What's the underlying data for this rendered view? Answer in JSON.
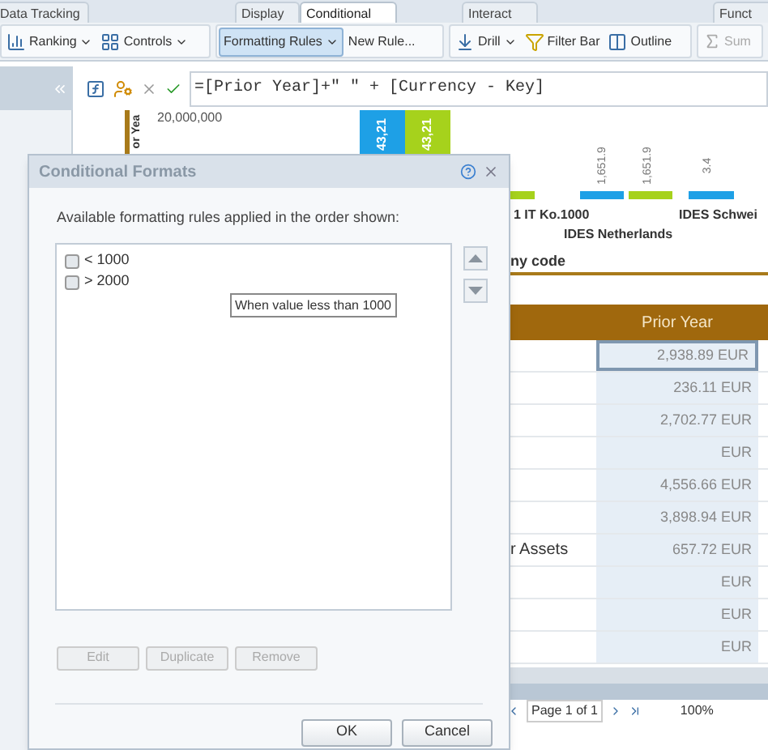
{
  "ribbon_tabs": [
    {
      "label": "Data Tracking",
      "selected": false
    },
    {
      "label": "Display",
      "selected": false
    },
    {
      "label": "Conditional",
      "selected": true
    },
    {
      "label": "Interact",
      "selected": false
    },
    {
      "label": "Funct",
      "selected": false
    }
  ],
  "toolbar_groups": [
    {
      "items": [
        {
          "kind": "ranking",
          "label": "Ranking",
          "dropdown": true,
          "pressed": false,
          "disabled": false
        },
        {
          "kind": "controls",
          "label": "Controls",
          "dropdown": true,
          "pressed": false,
          "disabled": false
        }
      ]
    },
    {
      "items": [
        {
          "kind": "plain",
          "label": "Formatting Rules",
          "dropdown": true,
          "pressed": true,
          "disabled": false
        },
        {
          "kind": "plain",
          "label": "New Rule...",
          "dropdown": false,
          "pressed": false,
          "disabled": false
        }
      ]
    },
    {
      "items": [
        {
          "kind": "drill",
          "label": "Drill",
          "dropdown": true,
          "pressed": false,
          "disabled": false
        },
        {
          "kind": "filter",
          "label": "Filter Bar",
          "dropdown": false,
          "pressed": false,
          "disabled": false
        },
        {
          "kind": "outline",
          "label": "Outline",
          "dropdown": false,
          "pressed": false,
          "disabled": false
        }
      ]
    },
    {
      "items": [
        {
          "kind": "sum",
          "label": "Sum",
          "dropdown": false,
          "pressed": false,
          "disabled": true
        }
      ]
    }
  ],
  "formula_bar": {
    "value": "=[Prior Year]+\" \" + [Currency - Key]"
  },
  "chart": {
    "axis_title": "or Yea",
    "y_tick": "20,000,000",
    "top_bar_labels": [
      "43,21",
      "43,21"
    ],
    "right_bar_labels": [
      "1,651.9",
      "1,651.9",
      "3.4"
    ],
    "categories": [
      "1 IT Ko.1000",
      "IDES Schwei",
      "IDES Netherlands"
    ]
  },
  "section_label": "ny code",
  "table": {
    "header": "Prior Year",
    "rows": [
      {
        "value": "2,938.89 EUR",
        "selected": true
      },
      {
        "value": "236.11 EUR",
        "selected": false
      },
      {
        "value": "2,702.77 EUR",
        "selected": false
      },
      {
        "value": "EUR",
        "selected": false
      },
      {
        "value": "4,556.66 EUR",
        "selected": false
      },
      {
        "value": "3,898.94 EUR",
        "selected": false
      },
      {
        "label": "r Assets",
        "value": "657.72 EUR",
        "selected": false
      },
      {
        "value": "EUR",
        "selected": false
      },
      {
        "value": "EUR",
        "selected": false
      },
      {
        "value": "EUR",
        "selected": false
      }
    ]
  },
  "pager": {
    "page": "Page 1 of 1",
    "zoom": "100%"
  },
  "dialog": {
    "title": "Conditional Formats",
    "instruction": "Available formatting rules applied in the order shown:",
    "rules": [
      {
        "label": "< 1000",
        "checked": false
      },
      {
        "label": "> 2000",
        "checked": false
      }
    ],
    "tooltip": "When value less than 1000",
    "rule_buttons": [
      {
        "label": "Edit",
        "disabled": true
      },
      {
        "label": "Duplicate",
        "disabled": true
      },
      {
        "label": "Remove",
        "disabled": true
      }
    ],
    "footer_buttons": [
      "OK",
      "Cancel"
    ]
  }
}
